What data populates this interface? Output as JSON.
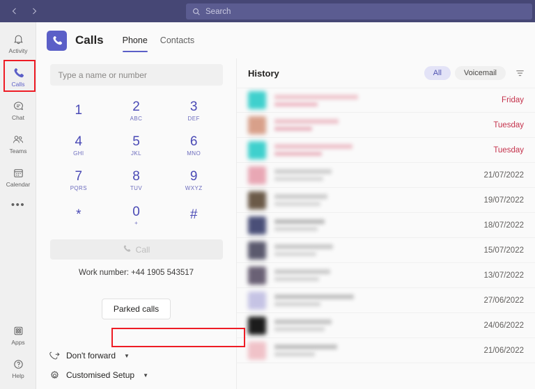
{
  "titlebar": {
    "back_icon": "chevron-left-icon",
    "forward_icon": "chevron-right-icon",
    "search": {
      "icon": "search-icon",
      "placeholder": "Search",
      "value": ""
    }
  },
  "appbar": {
    "items": [
      {
        "label": "Activity",
        "icon": "bell-icon",
        "active": false
      },
      {
        "label": "Calls",
        "icon": "phone-icon",
        "active": true
      },
      {
        "label": "Chat",
        "icon": "chat-icon",
        "active": false
      },
      {
        "label": "Teams",
        "icon": "teams-icon",
        "active": false
      },
      {
        "label": "Calendar",
        "icon": "calendar-icon",
        "active": false
      },
      {
        "label": "",
        "icon": "more-ellipsis-icon",
        "active": false
      }
    ],
    "bottom_items": [
      {
        "label": "Apps",
        "icon": "apps-grid-icon"
      },
      {
        "label": "Help",
        "icon": "help-circle-icon"
      }
    ]
  },
  "header": {
    "app_icon": "phone-icon",
    "title": "Calls",
    "tabs": [
      {
        "label": "Phone",
        "active": true
      },
      {
        "label": "Contacts",
        "active": false
      }
    ]
  },
  "dialpad": {
    "input_placeholder": "Type a name or number",
    "input_value": "",
    "keys": [
      {
        "digit": "1",
        "letters": ""
      },
      {
        "digit": "2",
        "letters": "ABC"
      },
      {
        "digit": "3",
        "letters": "DEF"
      },
      {
        "digit": "4",
        "letters": "GHI"
      },
      {
        "digit": "5",
        "letters": "JKL"
      },
      {
        "digit": "6",
        "letters": "MNO"
      },
      {
        "digit": "7",
        "letters": "PQRS"
      },
      {
        "digit": "8",
        "letters": "TUV"
      },
      {
        "digit": "9",
        "letters": "WXYZ"
      },
      {
        "digit": "*",
        "letters": ""
      },
      {
        "digit": "0",
        "letters": "+"
      },
      {
        "digit": "#",
        "letters": ""
      }
    ],
    "call_button": {
      "label": "Call",
      "icon": "phone-icon",
      "enabled": false
    },
    "work_number_label": "Work number: +44 1905 543517",
    "parked_calls_label": "Parked calls",
    "forwarding": {
      "icon": "call-forward-icon",
      "label": "Don't forward",
      "chevron": "chevron-down-icon"
    },
    "setup": {
      "icon": "gear-icon",
      "label": "Customised Setup",
      "chevron": "chevron-down-icon"
    }
  },
  "history": {
    "title": "History",
    "filters": [
      {
        "label": "All",
        "active": true
      },
      {
        "label": "Voicemail",
        "active": false
      }
    ],
    "filter_icon": "filter-funnel-icon",
    "rows": [
      {
        "date": "Friday",
        "missed": true,
        "avatar_color": "#3fd0cd",
        "name_color": "#f0c8cf",
        "sub_color": "#edb9c4"
      },
      {
        "date": "Tuesday",
        "missed": true,
        "avatar_color": "#d8a08a",
        "name_color": "#eec4cc",
        "sub_color": "#e9b5c0"
      },
      {
        "date": "Tuesday",
        "missed": true,
        "avatar_color": "#3fd0cd",
        "name_color": "#eec3cb",
        "sub_color": "#eab7c2"
      },
      {
        "date": "21/07/2022",
        "missed": false,
        "avatar_color": "#e8a7b4",
        "name_color": "#cfcfcf",
        "sub_color": "#d6d6d6"
      },
      {
        "date": "19/07/2022",
        "missed": false,
        "avatar_color": "#6b5a48",
        "name_color": "#cdcdcd",
        "sub_color": "#d6d6d6"
      },
      {
        "date": "18/07/2022",
        "missed": false,
        "avatar_color": "#4a4f78",
        "name_color": "#bcbcbc",
        "sub_color": "#d4d4d4"
      },
      {
        "date": "15/07/2022",
        "missed": false,
        "avatar_color": "#5b5a6e",
        "name_color": "#c9c9c9",
        "sub_color": "#d6d6d6"
      },
      {
        "date": "13/07/2022",
        "missed": false,
        "avatar_color": "#6a6175",
        "name_color": "#cbcbcb",
        "sub_color": "#d4d4d4"
      },
      {
        "date": "27/06/2022",
        "missed": false,
        "avatar_color": "#c5c3e4",
        "name_color": "#c2c2c2",
        "sub_color": "#d2d2d2"
      },
      {
        "date": "24/06/2022",
        "missed": false,
        "avatar_color": "#1c1c1c",
        "name_color": "#c4c4c4",
        "sub_color": "#d4d4d4"
      },
      {
        "date": "21/06/2022",
        "missed": false,
        "avatar_color": "#f0c2c8",
        "name_color": "#c0c0c0",
        "sub_color": "#d2d2d2"
      }
    ]
  },
  "annotations": {
    "highlight_color": "#ee1c25",
    "boxes": [
      {
        "target": "sidebar-item-calls"
      },
      {
        "target": "work-number-label"
      }
    ]
  },
  "colors": {
    "titlebar": "#464775",
    "accent": "#5b5fc7",
    "keypad_digit": "#4a4ab5",
    "missed_call": "#c4314b"
  }
}
